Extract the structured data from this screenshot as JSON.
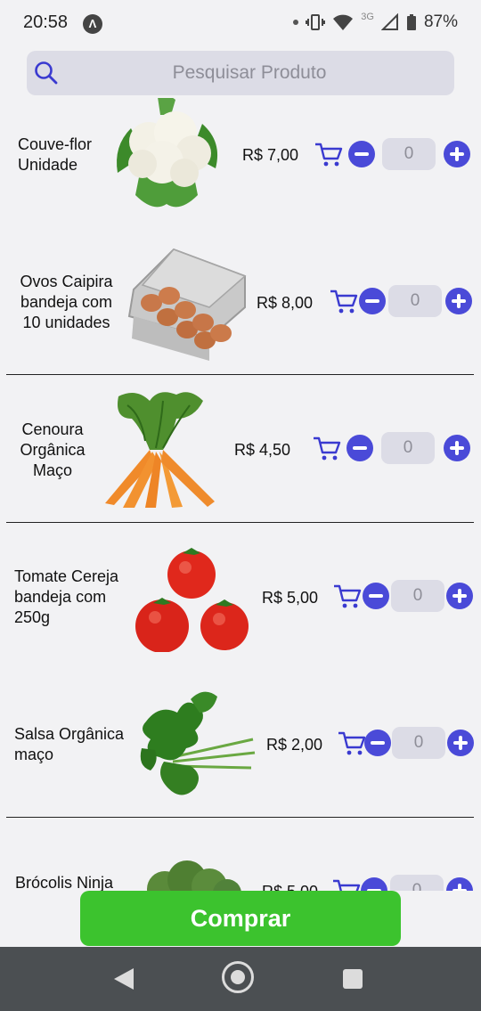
{
  "status_bar": {
    "time": "20:58",
    "network": "3G",
    "battery": "87%"
  },
  "search": {
    "placeholder": "Pesquisar Produto"
  },
  "products": [
    {
      "name": "Couve-flor Unidade",
      "price": "R$ 7,00",
      "quantity": "0",
      "image_icon": "cauliflower-image"
    },
    {
      "name": "Ovos Caipira bandeja com 10 unidades",
      "price": "R$ 8,00",
      "quantity": "0",
      "image_icon": "eggs-image"
    },
    {
      "name": "Cenoura Orgânica Maço",
      "price": "R$ 4,50",
      "quantity": "0",
      "image_icon": "carrots-image"
    },
    {
      "name": "Tomate Cereja bandeja com 250g",
      "price": "R$ 5,00",
      "quantity": "0",
      "image_icon": "tomatoes-image"
    },
    {
      "name": "Salsa Orgânica maço",
      "price": "R$ 2,00",
      "quantity": "0",
      "image_icon": "parsley-image"
    },
    {
      "name": "Brócolis Ninja",
      "price": "R$ 5,00",
      "quantity": "0",
      "image_icon": "broccoli-image"
    }
  ],
  "buy_button": {
    "label": "Comprar"
  },
  "colors": {
    "accent": "#4a4ad8",
    "buy_green": "#3cc32e",
    "background": "#f2f2f4",
    "input_bg": "#dcdce6",
    "nav_bar": "#4b4f52"
  }
}
